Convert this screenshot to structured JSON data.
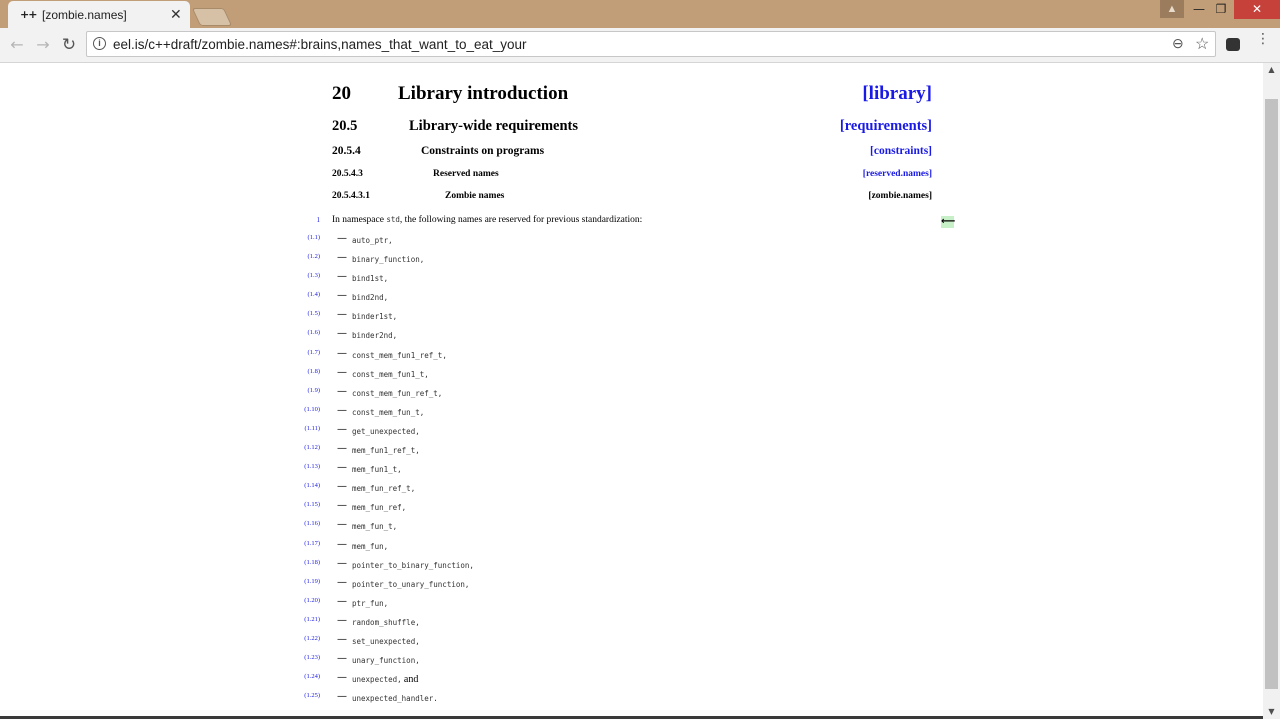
{
  "browser": {
    "tab": {
      "favicon": "++",
      "title": "[zombie.names]",
      "close": "✕"
    },
    "window_controls": {
      "profile": "▲",
      "minimize": "—",
      "restore": "❐",
      "close": "✕"
    },
    "nav": {
      "back": "←",
      "forward": "→",
      "reload": "↻"
    },
    "address": {
      "url": "eel.is/c++draft/zombie.names#:brains,names_that_want_to_eat_your"
    },
    "icons": {
      "info": "i",
      "zoom": "⊖",
      "star": "☆",
      "menu": "⋮"
    }
  },
  "scrollbar": {
    "up": "▲",
    "down": "▼"
  },
  "document": {
    "headings": [
      {
        "number": "20",
        "title": "Library introduction",
        "ref": "[library]",
        "link": true
      },
      {
        "number": "20.5",
        "title": "Library-wide requirements",
        "ref": "[requirements]",
        "link": true
      },
      {
        "number": "20.5.4",
        "title": "Constraints on programs",
        "ref": "[constraints]",
        "link": true
      },
      {
        "number": "20.5.4.3",
        "title": "Reserved names",
        "ref": "[reserved.names]",
        "link": true
      },
      {
        "number": "20.5.4.3.1",
        "title": "Zombie names",
        "ref": "[zombie.names]",
        "link": false
      }
    ],
    "paragraph": {
      "number": "1",
      "text_before": "In namespace ",
      "code": "std",
      "text_after": ", the following names are reserved for previous standardization:",
      "back_arrow": "⟵"
    },
    "dash": "—",
    "and_word": "and",
    "items": [
      {
        "num": "(1.1)",
        "name": "auto_ptr",
        "suffix": ","
      },
      {
        "num": "(1.2)",
        "name": "binary_function",
        "suffix": ","
      },
      {
        "num": "(1.3)",
        "name": "bind1st",
        "suffix": ","
      },
      {
        "num": "(1.4)",
        "name": "bind2nd",
        "suffix": ","
      },
      {
        "num": "(1.5)",
        "name": "binder1st",
        "suffix": ","
      },
      {
        "num": "(1.6)",
        "name": "binder2nd",
        "suffix": ","
      },
      {
        "num": "(1.7)",
        "name": "const_mem_fun1_ref_t",
        "suffix": ","
      },
      {
        "num": "(1.8)",
        "name": "const_mem_fun1_t",
        "suffix": ","
      },
      {
        "num": "(1.9)",
        "name": "const_mem_fun_ref_t",
        "suffix": ","
      },
      {
        "num": "(1.10)",
        "name": "const_mem_fun_t",
        "suffix": ","
      },
      {
        "num": "(1.11)",
        "name": "get_unexpected",
        "suffix": ","
      },
      {
        "num": "(1.12)",
        "name": "mem_fun1_ref_t",
        "suffix": ","
      },
      {
        "num": "(1.13)",
        "name": "mem_fun1_t",
        "suffix": ","
      },
      {
        "num": "(1.14)",
        "name": "mem_fun_ref_t",
        "suffix": ","
      },
      {
        "num": "(1.15)",
        "name": "mem_fun_ref",
        "suffix": ","
      },
      {
        "num": "(1.16)",
        "name": "mem_fun_t",
        "suffix": ","
      },
      {
        "num": "(1.17)",
        "name": "mem_fun",
        "suffix": ","
      },
      {
        "num": "(1.18)",
        "name": "pointer_to_binary_function",
        "suffix": ","
      },
      {
        "num": "(1.19)",
        "name": "pointer_to_unary_function",
        "suffix": ","
      },
      {
        "num": "(1.20)",
        "name": "ptr_fun",
        "suffix": ","
      },
      {
        "num": "(1.21)",
        "name": "random_shuffle",
        "suffix": ","
      },
      {
        "num": "(1.22)",
        "name": "set_unexpected",
        "suffix": ","
      },
      {
        "num": "(1.23)",
        "name": "unary_function",
        "suffix": ","
      },
      {
        "num": "(1.24)",
        "name": "unexpected",
        "suffix": ",",
        "and": true
      },
      {
        "num": "(1.25)",
        "name": "unexpected_handler",
        "suffix": "."
      }
    ]
  },
  "colors": {
    "titlebar": "#c19e77",
    "link": "#1a1ae6",
    "close_button": "#c7413b",
    "back_arrow_bg": "#c8f0c8"
  }
}
